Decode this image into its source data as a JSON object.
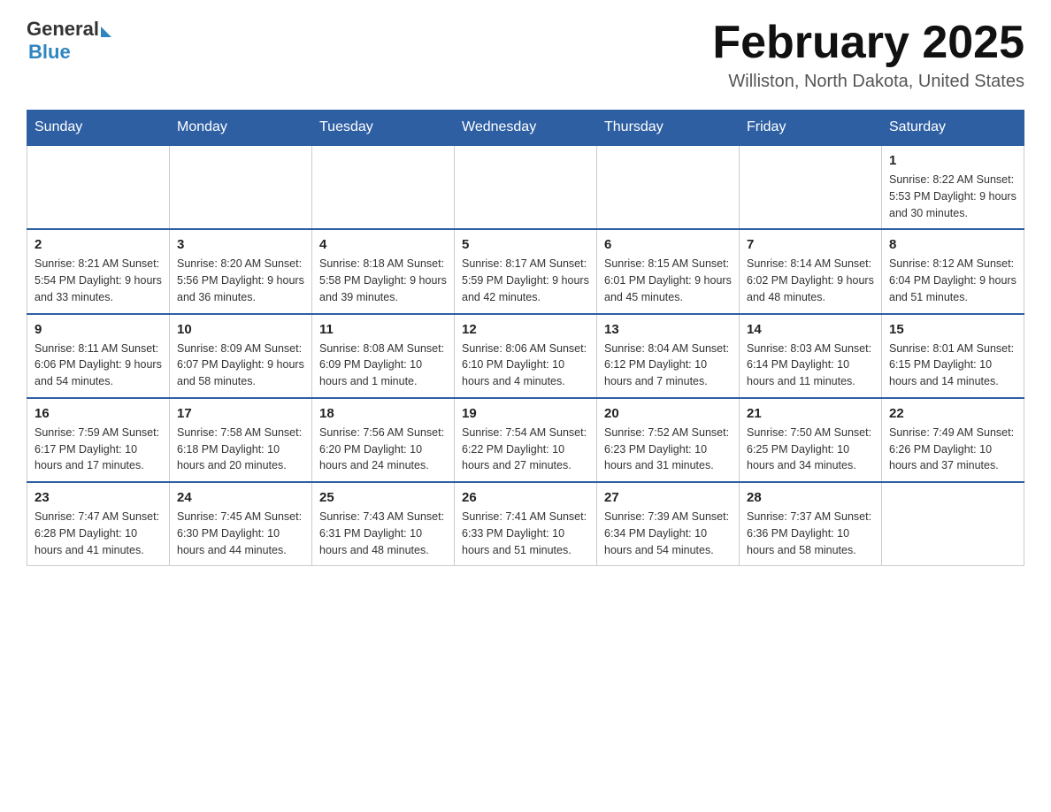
{
  "header": {
    "logo_general": "General",
    "logo_blue": "Blue",
    "title": "February 2025",
    "subtitle": "Williston, North Dakota, United States"
  },
  "days_of_week": [
    "Sunday",
    "Monday",
    "Tuesday",
    "Wednesday",
    "Thursday",
    "Friday",
    "Saturday"
  ],
  "weeks": [
    {
      "days": [
        {
          "num": "",
          "info": ""
        },
        {
          "num": "",
          "info": ""
        },
        {
          "num": "",
          "info": ""
        },
        {
          "num": "",
          "info": ""
        },
        {
          "num": "",
          "info": ""
        },
        {
          "num": "",
          "info": ""
        },
        {
          "num": "1",
          "info": "Sunrise: 8:22 AM\nSunset: 5:53 PM\nDaylight: 9 hours and 30 minutes."
        }
      ]
    },
    {
      "days": [
        {
          "num": "2",
          "info": "Sunrise: 8:21 AM\nSunset: 5:54 PM\nDaylight: 9 hours and 33 minutes."
        },
        {
          "num": "3",
          "info": "Sunrise: 8:20 AM\nSunset: 5:56 PM\nDaylight: 9 hours and 36 minutes."
        },
        {
          "num": "4",
          "info": "Sunrise: 8:18 AM\nSunset: 5:58 PM\nDaylight: 9 hours and 39 minutes."
        },
        {
          "num": "5",
          "info": "Sunrise: 8:17 AM\nSunset: 5:59 PM\nDaylight: 9 hours and 42 minutes."
        },
        {
          "num": "6",
          "info": "Sunrise: 8:15 AM\nSunset: 6:01 PM\nDaylight: 9 hours and 45 minutes."
        },
        {
          "num": "7",
          "info": "Sunrise: 8:14 AM\nSunset: 6:02 PM\nDaylight: 9 hours and 48 minutes."
        },
        {
          "num": "8",
          "info": "Sunrise: 8:12 AM\nSunset: 6:04 PM\nDaylight: 9 hours and 51 minutes."
        }
      ]
    },
    {
      "days": [
        {
          "num": "9",
          "info": "Sunrise: 8:11 AM\nSunset: 6:06 PM\nDaylight: 9 hours and 54 minutes."
        },
        {
          "num": "10",
          "info": "Sunrise: 8:09 AM\nSunset: 6:07 PM\nDaylight: 9 hours and 58 minutes."
        },
        {
          "num": "11",
          "info": "Sunrise: 8:08 AM\nSunset: 6:09 PM\nDaylight: 10 hours and 1 minute."
        },
        {
          "num": "12",
          "info": "Sunrise: 8:06 AM\nSunset: 6:10 PM\nDaylight: 10 hours and 4 minutes."
        },
        {
          "num": "13",
          "info": "Sunrise: 8:04 AM\nSunset: 6:12 PM\nDaylight: 10 hours and 7 minutes."
        },
        {
          "num": "14",
          "info": "Sunrise: 8:03 AM\nSunset: 6:14 PM\nDaylight: 10 hours and 11 minutes."
        },
        {
          "num": "15",
          "info": "Sunrise: 8:01 AM\nSunset: 6:15 PM\nDaylight: 10 hours and 14 minutes."
        }
      ]
    },
    {
      "days": [
        {
          "num": "16",
          "info": "Sunrise: 7:59 AM\nSunset: 6:17 PM\nDaylight: 10 hours and 17 minutes."
        },
        {
          "num": "17",
          "info": "Sunrise: 7:58 AM\nSunset: 6:18 PM\nDaylight: 10 hours and 20 minutes."
        },
        {
          "num": "18",
          "info": "Sunrise: 7:56 AM\nSunset: 6:20 PM\nDaylight: 10 hours and 24 minutes."
        },
        {
          "num": "19",
          "info": "Sunrise: 7:54 AM\nSunset: 6:22 PM\nDaylight: 10 hours and 27 minutes."
        },
        {
          "num": "20",
          "info": "Sunrise: 7:52 AM\nSunset: 6:23 PM\nDaylight: 10 hours and 31 minutes."
        },
        {
          "num": "21",
          "info": "Sunrise: 7:50 AM\nSunset: 6:25 PM\nDaylight: 10 hours and 34 minutes."
        },
        {
          "num": "22",
          "info": "Sunrise: 7:49 AM\nSunset: 6:26 PM\nDaylight: 10 hours and 37 minutes."
        }
      ]
    },
    {
      "days": [
        {
          "num": "23",
          "info": "Sunrise: 7:47 AM\nSunset: 6:28 PM\nDaylight: 10 hours and 41 minutes."
        },
        {
          "num": "24",
          "info": "Sunrise: 7:45 AM\nSunset: 6:30 PM\nDaylight: 10 hours and 44 minutes."
        },
        {
          "num": "25",
          "info": "Sunrise: 7:43 AM\nSunset: 6:31 PM\nDaylight: 10 hours and 48 minutes."
        },
        {
          "num": "26",
          "info": "Sunrise: 7:41 AM\nSunset: 6:33 PM\nDaylight: 10 hours and 51 minutes."
        },
        {
          "num": "27",
          "info": "Sunrise: 7:39 AM\nSunset: 6:34 PM\nDaylight: 10 hours and 54 minutes."
        },
        {
          "num": "28",
          "info": "Sunrise: 7:37 AM\nSunset: 6:36 PM\nDaylight: 10 hours and 58 minutes."
        },
        {
          "num": "",
          "info": ""
        }
      ]
    }
  ]
}
